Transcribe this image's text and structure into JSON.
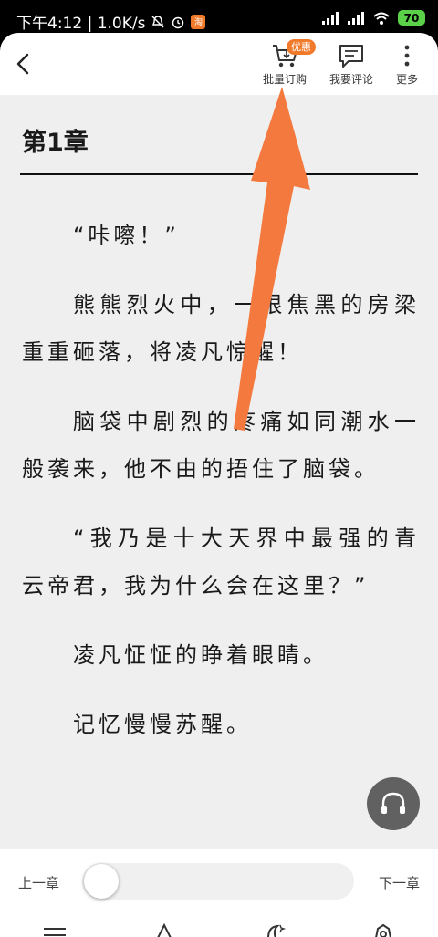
{
  "status_bar": {
    "time_info": "下午4:12 | 1.0K/s",
    "app_badge": "淘",
    "battery": "70"
  },
  "toolbar": {
    "batch_order_label": "批量订购",
    "promo_badge": "优惠",
    "comment_label": "我要评论",
    "more_label": "更多"
  },
  "reader": {
    "chapter_title": "第1章",
    "paragraphs": [
      "“咔嚓！”",
      "熊熊烈火中，一根焦黑的房梁重重砸落，将凌凡惊醒！",
      "脑袋中剧烈的疼痛如同潮水一般袭来，他不由的捂住了脑袋。",
      "“我乃是十大天界中最强的青云帝君，我为什么会在这里？”",
      "凌凡怔怔的睁着眼睛。",
      "记忆慢慢苏醒。"
    ]
  },
  "bottom_panel": {
    "prev_chapter": "上一章",
    "next_chapter": "下一章",
    "progress_fraction": 0.0
  },
  "colors": {
    "accent_orange": "#f07a2a",
    "reader_bg": "#efefef",
    "annotation_arrow": "#f4793e"
  }
}
